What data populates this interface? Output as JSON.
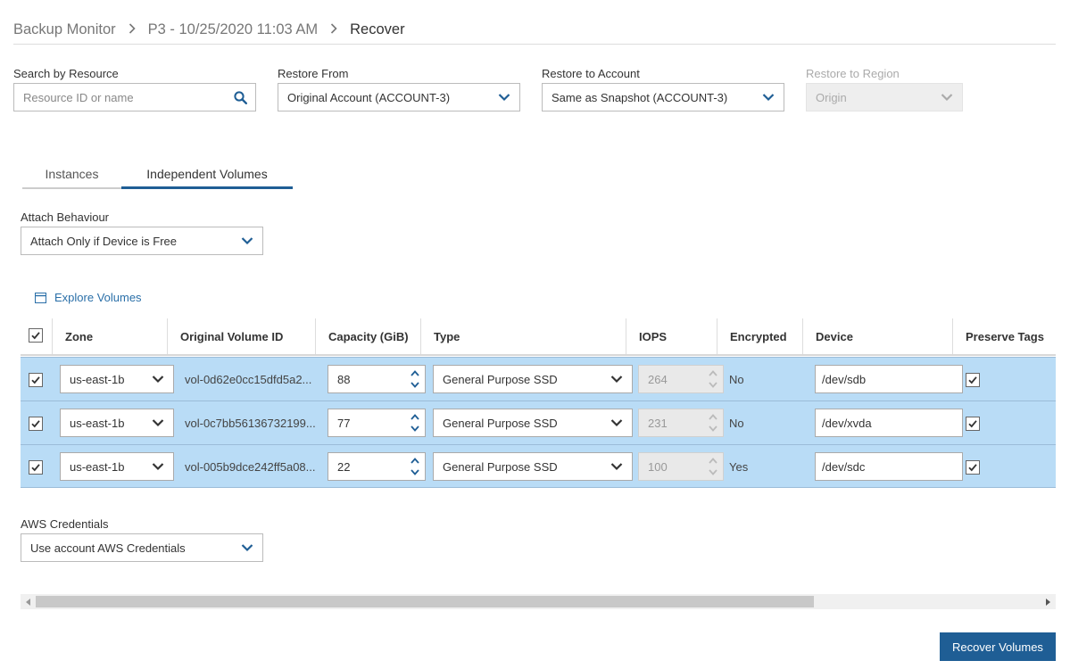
{
  "breadcrumb": {
    "items": [
      "Backup Monitor",
      "P3 - 10/25/2020 11:03 AM",
      "Recover"
    ]
  },
  "filters": {
    "search": {
      "label": "Search by Resource",
      "placeholder": "Resource ID or name"
    },
    "restore_from": {
      "label": "Restore From",
      "value": "Original Account (ACCOUNT-3)"
    },
    "restore_to_account": {
      "label": "Restore to Account",
      "value": "Same as Snapshot (ACCOUNT-3)"
    },
    "restore_to_region": {
      "label": "Restore to Region",
      "value": "Origin",
      "disabled": true
    }
  },
  "tabs": [
    {
      "label": "Instances",
      "active": false
    },
    {
      "label": "Independent Volumes",
      "active": true
    }
  ],
  "attach_behaviour": {
    "label": "Attach Behaviour",
    "value": "Attach Only if Device is Free"
  },
  "explore_link": "Explore Volumes",
  "table": {
    "columns": [
      "Zone",
      "Original Volume ID",
      "Capacity (GiB)",
      "Type",
      "IOPS",
      "Encrypted",
      "Device",
      "Preserve Tags"
    ],
    "rows": [
      {
        "selected": true,
        "zone": "us-east-1b",
        "volume_id": "vol-0d62e0cc15dfd5a2...",
        "capacity": "88",
        "type": "General Purpose SSD",
        "iops": "264",
        "encrypted": "No",
        "device": "/dev/sdb",
        "preserve_tags": true
      },
      {
        "selected": true,
        "zone": "us-east-1b",
        "volume_id": "vol-0c7bb56136732199...",
        "capacity": "77",
        "type": "General Purpose SSD",
        "iops": "231",
        "encrypted": "No",
        "device": "/dev/xvda",
        "preserve_tags": true
      },
      {
        "selected": true,
        "zone": "us-east-1b",
        "volume_id": "vol-005b9dce242ff5a08...",
        "capacity": "22",
        "type": "General Purpose SSD",
        "iops": "100",
        "encrypted": "Yes",
        "device": "/dev/sdc",
        "preserve_tags": true
      }
    ]
  },
  "aws_credentials": {
    "label": "AWS Credentials",
    "value": "Use account AWS Credentials"
  },
  "actions": {
    "recover_label": "Recover Volumes"
  },
  "colors": {
    "accent": "#1f5e95",
    "row_highlight": "#b9dcf6",
    "link": "#2a6fa8"
  },
  "icons": [
    "search-icon",
    "chevron-down-icon",
    "chevron-right-icon",
    "calendar-icon",
    "checkmark-icon",
    "spinner-arrows-icon",
    "scroll-left-icon",
    "scroll-right-icon"
  ]
}
